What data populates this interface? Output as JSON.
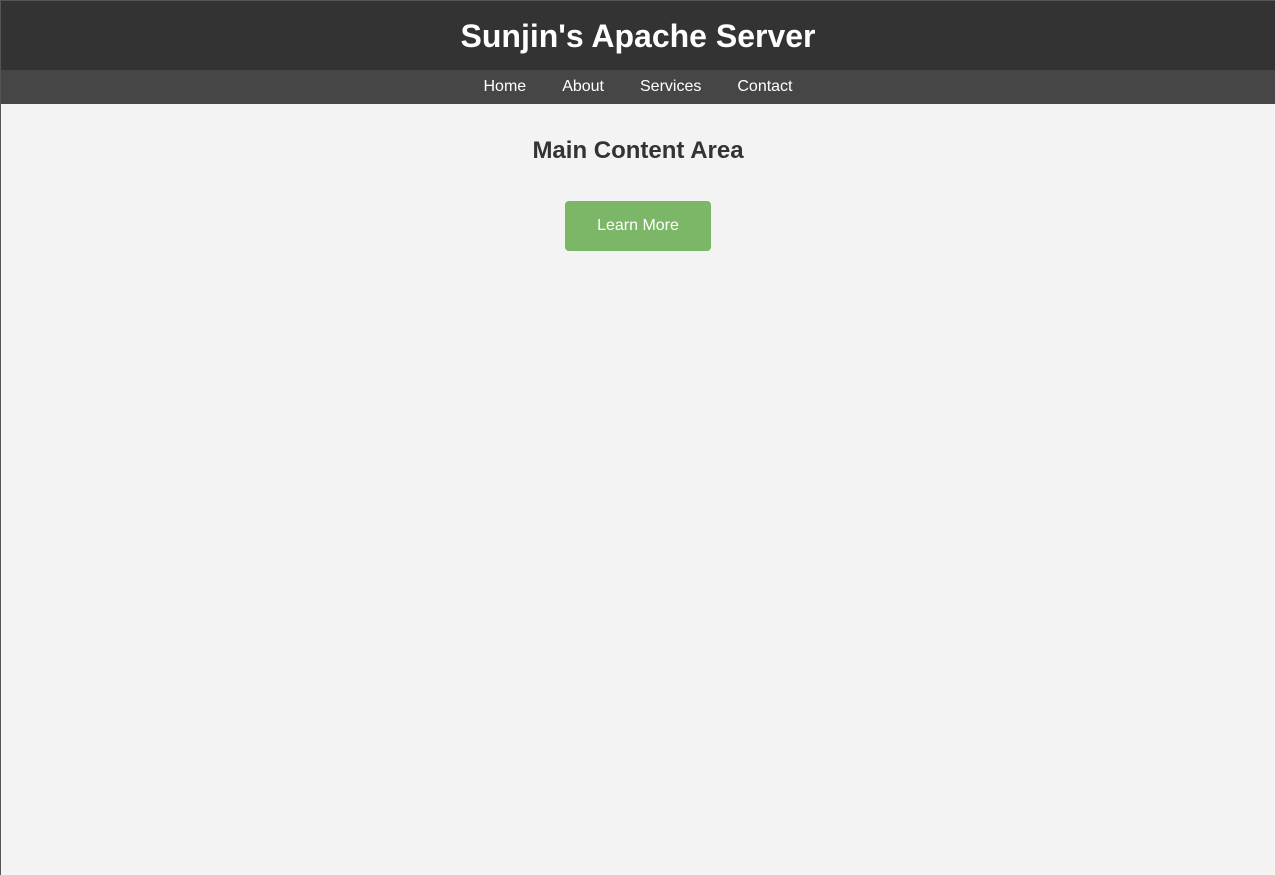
{
  "header": {
    "title": "Sunjin's Apache Server"
  },
  "nav": {
    "items": [
      {
        "label": "Home"
      },
      {
        "label": "About"
      },
      {
        "label": "Services"
      },
      {
        "label": "Contact"
      }
    ]
  },
  "main": {
    "heading": "Main Content Area",
    "button_label": "Learn More"
  },
  "colors": {
    "header_bg": "#333333",
    "nav_bg": "#464646",
    "page_bg": "#f3f3f3",
    "button_bg": "#7cb767",
    "heading_text": "#333333"
  }
}
